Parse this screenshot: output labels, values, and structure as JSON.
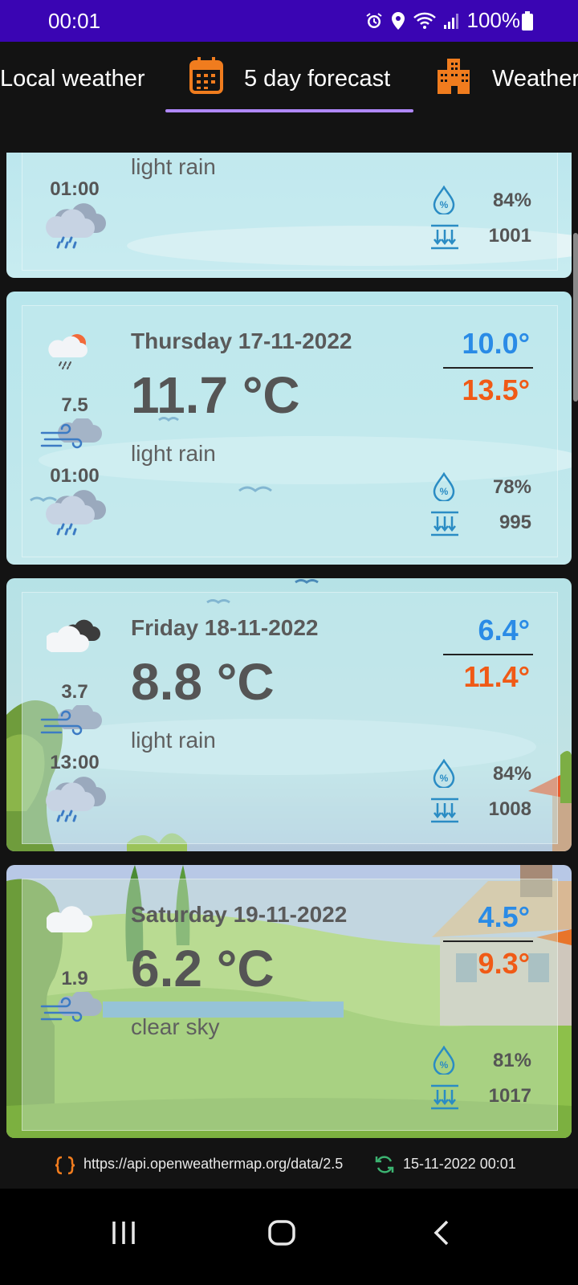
{
  "status_bar": {
    "time": "00:01",
    "battery": "100%"
  },
  "tabs": [
    {
      "label": "Local weather"
    },
    {
      "label": "5 day forecast",
      "selected": true
    },
    {
      "label": "Weather"
    }
  ],
  "forecast": [
    {
      "date": "",
      "temp": "",
      "description": "light rain",
      "min": "",
      "max": "",
      "wind": "",
      "hour": "01:00",
      "humidity": "84%",
      "pressure": "1001",
      "icon": "rain-cloud-icon"
    },
    {
      "date": "Thursday 17-11-2022",
      "temp": "11.7 °C",
      "description": "light rain",
      "min": "10.0°",
      "max": "13.5°",
      "wind": "7.5",
      "hour": "01:00",
      "humidity": "78%",
      "pressure": "995",
      "icon": "sun-cloud-rain-icon"
    },
    {
      "date": "Friday 18-11-2022",
      "temp": "8.8 °C",
      "description": "light rain",
      "min": "6.4°",
      "max": "11.4°",
      "wind": "3.7",
      "hour": "13:00",
      "humidity": "84%",
      "pressure": "1008",
      "icon": "dark-cloud-icon"
    },
    {
      "date": "Saturday 19-11-2022",
      "temp": "6.2 °C",
      "description": "clear sky",
      "min": "4.5°",
      "max": "9.3°",
      "wind": "1.9",
      "hour": "",
      "humidity": "81%",
      "pressure": "1017",
      "icon": "cloud-icon"
    }
  ],
  "footer": {
    "api_url": "https://api.openweathermap.org/data/2.5",
    "last_update": "15-11-2022 00:01"
  },
  "colors": {
    "status_bar": "#3a05b3",
    "accent_orange": "#f07c1e",
    "min_temp": "#2a8be6",
    "max_temp": "#f05a16",
    "tab_indicator": "#b088ff"
  }
}
